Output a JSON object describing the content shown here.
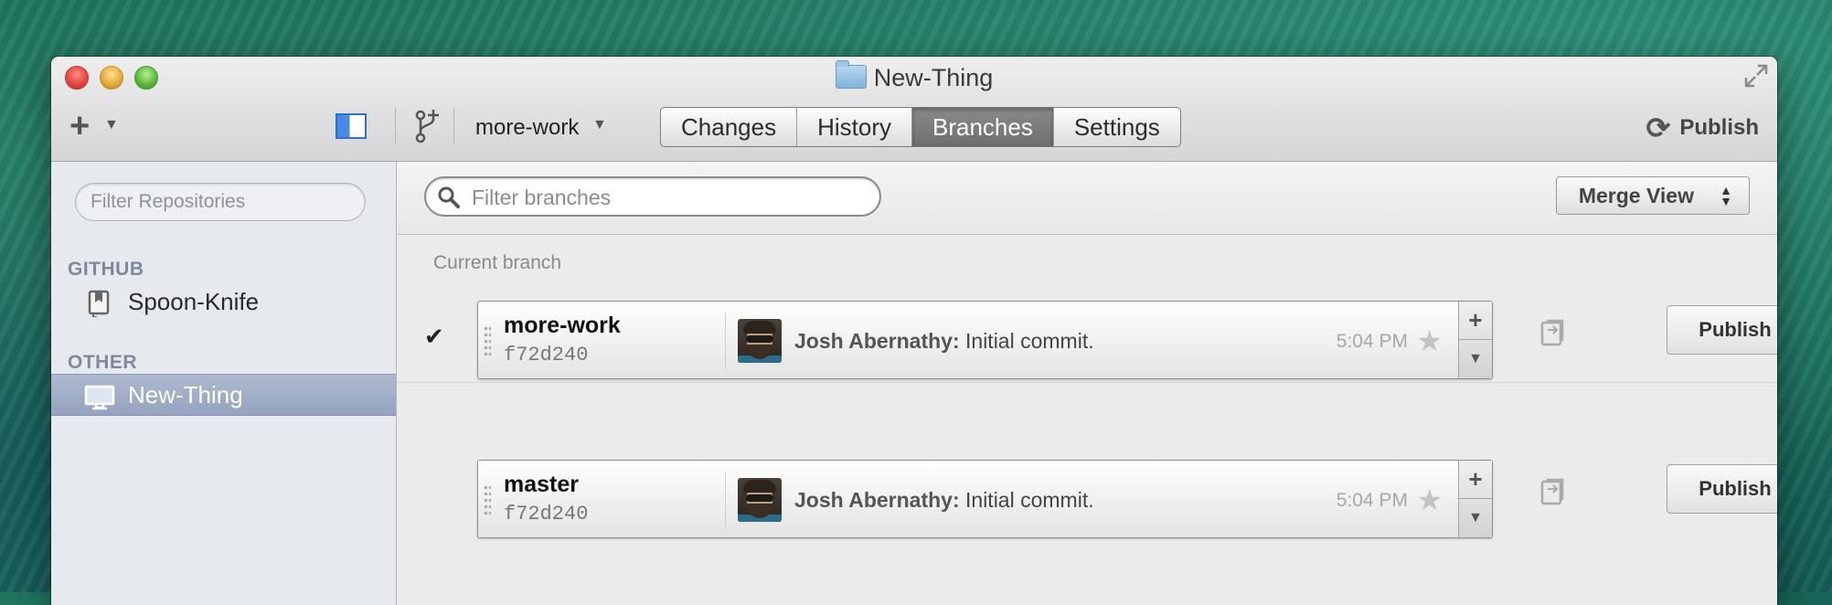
{
  "window": {
    "title": "New-Thing"
  },
  "toolbar": {
    "add_label": "+",
    "current_branch": "more-work",
    "tabs": [
      {
        "label": "Changes",
        "active": false
      },
      {
        "label": "History",
        "active": false
      },
      {
        "label": "Branches",
        "active": true
      },
      {
        "label": "Settings",
        "active": false
      }
    ],
    "publish_label": "Publish"
  },
  "sidebar": {
    "filter_placeholder": "Filter Repositories",
    "sections": [
      {
        "heading": "GITHUB",
        "items": [
          {
            "label": "Spoon-Knife",
            "icon": "repo-icon",
            "selected": false
          }
        ]
      },
      {
        "heading": "OTHER",
        "items": [
          {
            "label": "New-Thing",
            "icon": "monitor-icon",
            "selected": true
          }
        ]
      }
    ]
  },
  "main": {
    "filter_placeholder": "Filter branches",
    "merge_view_label": "Merge View",
    "current_branch_label": "Current branch",
    "branches": [
      {
        "name": "more-work",
        "sha": "f72d240",
        "author": "Josh Abernathy:",
        "message": "Initial commit.",
        "time": "5:04 PM",
        "current": true,
        "publish_label": "Publish"
      },
      {
        "name": "master",
        "sha": "f72d240",
        "author": "Josh Abernathy:",
        "message": "Initial commit.",
        "time": "5:04 PM",
        "current": false,
        "publish_label": "Publish"
      }
    ]
  },
  "colors": {
    "selected_sidebar": "#95a3c0",
    "active_tab": "#777777",
    "accent_blue": "#2f6fd2"
  }
}
